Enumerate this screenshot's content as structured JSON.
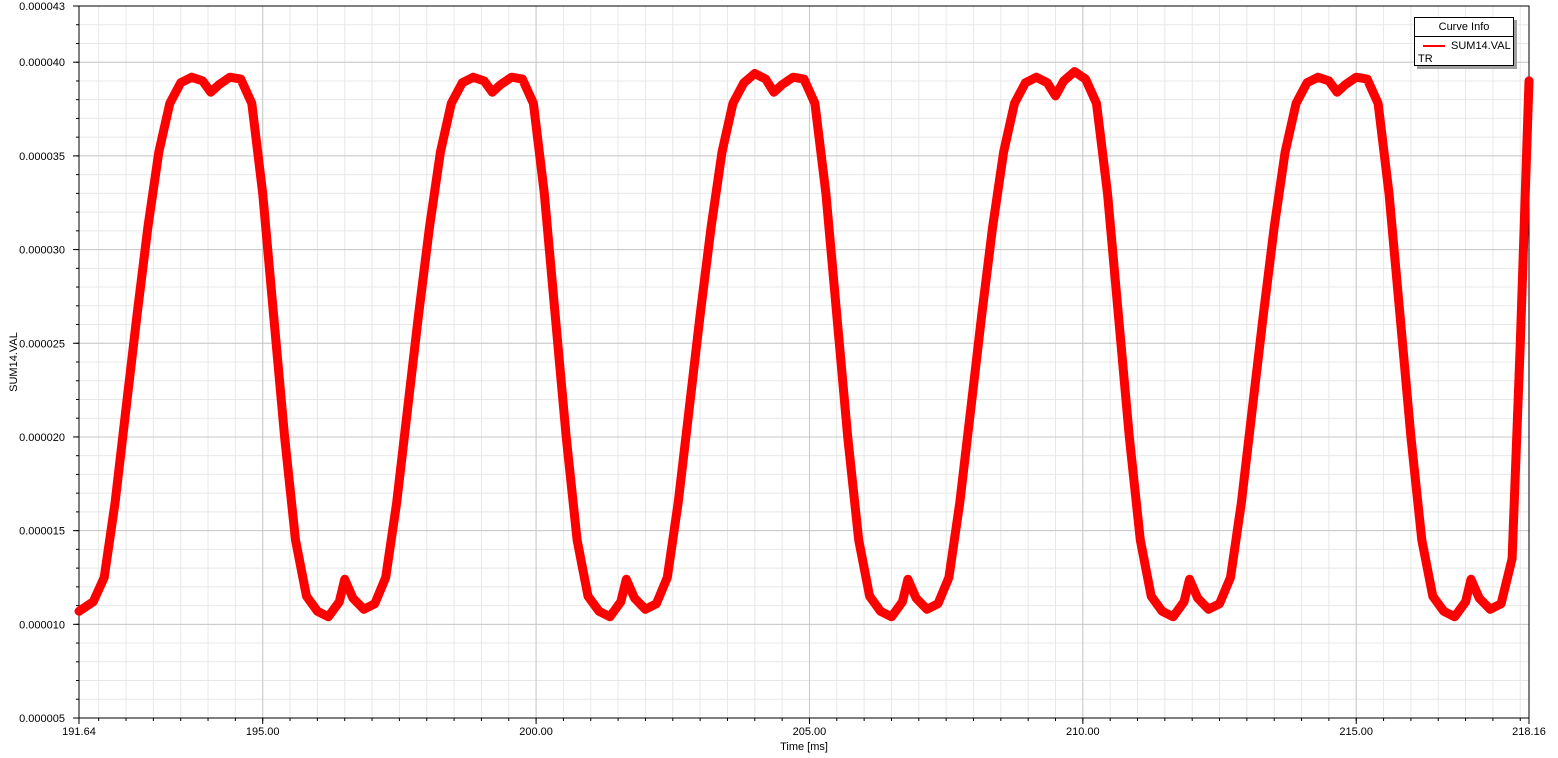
{
  "chart_data": {
    "type": "line",
    "xlabel": "Time [ms]",
    "ylabel": "SUM14.VAL",
    "xlim": [
      191.64,
      218.16
    ],
    "ylim": [
      5e-06,
      4.3e-05
    ],
    "xticks": [
      191.64,
      195.0,
      200.0,
      205.0,
      210.0,
      215.0,
      218.16
    ],
    "xtick_labels": [
      "191.64",
      "195.00",
      "200.00",
      "205.00",
      "210.00",
      "215.00",
      "218.16"
    ],
    "yticks": [
      5e-06,
      1e-05,
      1.5e-05,
      2e-05,
      2.5e-05,
      3e-05,
      3.5e-05,
      4e-05,
      4.3e-05
    ],
    "ytick_labels": [
      "0.000005",
      "0.000010",
      "0.000015",
      "0.000020",
      "0.000025",
      "0.000030",
      "0.000035",
      "0.000040",
      "0.000043"
    ],
    "grid": true,
    "legend": {
      "title": "Curve Info",
      "placement": "top-right",
      "entries": [
        {
          "name": "SUM14.VAL",
          "group": "TR",
          "color": "#ff0000"
        }
      ]
    },
    "series": [
      {
        "name": "SUM14.VAL",
        "color": "#ff0000",
        "points": [
          [
            191.64,
            1.07e-05
          ],
          [
            191.9,
            1.12e-05
          ],
          [
            192.1,
            1.25e-05
          ],
          [
            192.3,
            1.65e-05
          ],
          [
            192.5,
            2.15e-05
          ],
          [
            192.7,
            2.65e-05
          ],
          [
            192.9,
            3.12e-05
          ],
          [
            193.1,
            3.52e-05
          ],
          [
            193.3,
            3.78e-05
          ],
          [
            193.5,
            3.89e-05
          ],
          [
            193.7,
            3.92e-05
          ],
          [
            193.9,
            3.9e-05
          ],
          [
            194.05,
            3.84e-05
          ],
          [
            194.2,
            3.88e-05
          ],
          [
            194.4,
            3.92e-05
          ],
          [
            194.6,
            3.91e-05
          ],
          [
            194.8,
            3.78e-05
          ],
          [
            195.0,
            3.3e-05
          ],
          [
            195.2,
            2.65e-05
          ],
          [
            195.4,
            2e-05
          ],
          [
            195.6,
            1.45e-05
          ],
          [
            195.8,
            1.15e-05
          ],
          [
            196.0,
            1.07e-05
          ],
          [
            196.2,
            1.04e-05
          ],
          [
            196.4,
            1.12e-05
          ],
          [
            196.5,
            1.24e-05
          ],
          [
            196.65,
            1.14e-05
          ],
          [
            196.85,
            1.08e-05
          ],
          [
            197.05,
            1.11e-05
          ],
          [
            197.25,
            1.25e-05
          ],
          [
            197.45,
            1.65e-05
          ],
          [
            197.65,
            2.15e-05
          ],
          [
            197.85,
            2.65e-05
          ],
          [
            198.05,
            3.12e-05
          ],
          [
            198.25,
            3.52e-05
          ],
          [
            198.45,
            3.78e-05
          ],
          [
            198.65,
            3.89e-05
          ],
          [
            198.85,
            3.92e-05
          ],
          [
            199.05,
            3.9e-05
          ],
          [
            199.2,
            3.84e-05
          ],
          [
            199.35,
            3.88e-05
          ],
          [
            199.55,
            3.92e-05
          ],
          [
            199.75,
            3.91e-05
          ],
          [
            199.95,
            3.78e-05
          ],
          [
            200.15,
            3.3e-05
          ],
          [
            200.35,
            2.65e-05
          ],
          [
            200.55,
            2e-05
          ],
          [
            200.75,
            1.45e-05
          ],
          [
            200.95,
            1.15e-05
          ],
          [
            201.15,
            1.07e-05
          ],
          [
            201.35,
            1.04e-05
          ],
          [
            201.55,
            1.12e-05
          ],
          [
            201.65,
            1.24e-05
          ],
          [
            201.8,
            1.14e-05
          ],
          [
            202.0,
            1.08e-05
          ],
          [
            202.2,
            1.11e-05
          ],
          [
            202.4,
            1.25e-05
          ],
          [
            202.6,
            1.65e-05
          ],
          [
            202.8,
            2.15e-05
          ],
          [
            203.0,
            2.65e-05
          ],
          [
            203.2,
            3.12e-05
          ],
          [
            203.4,
            3.52e-05
          ],
          [
            203.6,
            3.78e-05
          ],
          [
            203.8,
            3.89e-05
          ],
          [
            204.0,
            3.94e-05
          ],
          [
            204.2,
            3.91e-05
          ],
          [
            204.35,
            3.84e-05
          ],
          [
            204.5,
            3.88e-05
          ],
          [
            204.7,
            3.92e-05
          ],
          [
            204.9,
            3.91e-05
          ],
          [
            205.1,
            3.78e-05
          ],
          [
            205.3,
            3.3e-05
          ],
          [
            205.5,
            2.65e-05
          ],
          [
            205.7,
            2e-05
          ],
          [
            205.9,
            1.45e-05
          ],
          [
            206.1,
            1.15e-05
          ],
          [
            206.3,
            1.07e-05
          ],
          [
            206.5,
            1.04e-05
          ],
          [
            206.7,
            1.12e-05
          ],
          [
            206.8,
            1.24e-05
          ],
          [
            206.95,
            1.14e-05
          ],
          [
            207.15,
            1.08e-05
          ],
          [
            207.35,
            1.11e-05
          ],
          [
            207.55,
            1.25e-05
          ],
          [
            207.75,
            1.65e-05
          ],
          [
            207.95,
            2.15e-05
          ],
          [
            208.15,
            2.65e-05
          ],
          [
            208.35,
            3.12e-05
          ],
          [
            208.55,
            3.52e-05
          ],
          [
            208.75,
            3.78e-05
          ],
          [
            208.95,
            3.89e-05
          ],
          [
            209.15,
            3.92e-05
          ],
          [
            209.35,
            3.89e-05
          ],
          [
            209.5,
            3.82e-05
          ],
          [
            209.65,
            3.9e-05
          ],
          [
            209.85,
            3.95e-05
          ],
          [
            210.05,
            3.91e-05
          ],
          [
            210.25,
            3.78e-05
          ],
          [
            210.45,
            3.3e-05
          ],
          [
            210.65,
            2.65e-05
          ],
          [
            210.85,
            2e-05
          ],
          [
            211.05,
            1.45e-05
          ],
          [
            211.25,
            1.15e-05
          ],
          [
            211.45,
            1.07e-05
          ],
          [
            211.65,
            1.04e-05
          ],
          [
            211.85,
            1.12e-05
          ],
          [
            211.95,
            1.24e-05
          ],
          [
            212.1,
            1.14e-05
          ],
          [
            212.3,
            1.08e-05
          ],
          [
            212.5,
            1.11e-05
          ],
          [
            212.7,
            1.25e-05
          ],
          [
            212.9,
            1.65e-05
          ],
          [
            213.1,
            2.15e-05
          ],
          [
            213.3,
            2.65e-05
          ],
          [
            213.5,
            3.12e-05
          ],
          [
            213.7,
            3.52e-05
          ],
          [
            213.9,
            3.78e-05
          ],
          [
            214.1,
            3.89e-05
          ],
          [
            214.3,
            3.92e-05
          ],
          [
            214.5,
            3.9e-05
          ],
          [
            214.65,
            3.84e-05
          ],
          [
            214.8,
            3.88e-05
          ],
          [
            215.0,
            3.92e-05
          ],
          [
            215.2,
            3.91e-05
          ],
          [
            215.4,
            3.78e-05
          ],
          [
            215.6,
            3.3e-05
          ],
          [
            215.8,
            2.65e-05
          ],
          [
            216.0,
            2e-05
          ],
          [
            216.2,
            1.45e-05
          ],
          [
            216.4,
            1.15e-05
          ],
          [
            216.6,
            1.07e-05
          ],
          [
            216.8,
            1.04e-05
          ],
          [
            217.0,
            1.12e-05
          ],
          [
            217.1,
            1.24e-05
          ],
          [
            217.25,
            1.14e-05
          ],
          [
            217.45,
            1.08e-05
          ],
          [
            217.65,
            1.11e-05
          ],
          [
            217.85,
            1.35e-05
          ],
          [
            218.0,
            2.5e-05
          ],
          [
            218.16,
            3.9e-05
          ]
        ]
      }
    ]
  }
}
